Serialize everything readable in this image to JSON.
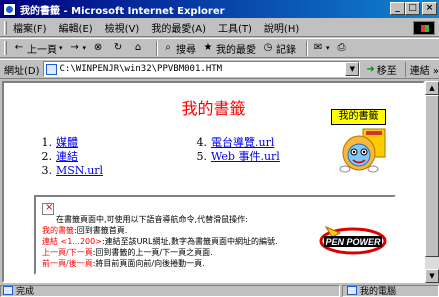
{
  "window": {
    "title": "我的書籤 - Microsoft Internet Explorer",
    "minimize": "_",
    "maximize": "□",
    "close": "×"
  },
  "menu": [
    "檔案(F)",
    "編輯(E)",
    "檢視(V)",
    "我的最愛(A)",
    "工具(T)",
    "說明(H)"
  ],
  "toolbar": {
    "back": "上一頁",
    "back_icon": "←",
    "forward_icon": "→",
    "stop_icon": "⊗",
    "refresh_icon": "↻",
    "home_icon": "⌂",
    "search": "搜尋",
    "search_icon": "⌕",
    "favorites": "我的最愛",
    "favorites_icon": "★",
    "history": "記錄",
    "history_icon": "◷",
    "mail_icon": "✉",
    "print_icon": "⎙"
  },
  "address": {
    "label": "網址(D)",
    "value": "C:\\WINPENJR\\win32\\PPVBM001.HTM",
    "go": "移至",
    "links": "連結 »"
  },
  "page": {
    "heading": "我的書籤",
    "mascot_label": "我的書籤",
    "favorites_left": [
      {
        "num": "1.",
        "text": "媒體"
      },
      {
        "num": "2.",
        "text": "連結"
      },
      {
        "num": "3.",
        "text": "MSN.url"
      }
    ],
    "favorites_right": [
      {
        "num": "4.",
        "text": "電台導覽.url"
      },
      {
        "num": "5.",
        "text": "Web 事件.url"
      }
    ],
    "info": {
      "intro": "在書籤頁面中,可使用以下語音導航命令,代替滑鼠操作:",
      "lines": [
        {
          "key": "我的書籤",
          "desc": ":回到書籤首頁."
        },
        {
          "key": "連結 <1...200>",
          "desc": ":連結至該URL網址,數字為書籤頁面中網址的編號."
        },
        {
          "key": "上一頁/下一頁",
          "desc": ":回到書籤的上一頁/下一頁之頁面."
        },
        {
          "key": "前一頁/後一頁",
          "desc": ":將目前頁面向前/向後捲動一頁."
        }
      ],
      "logo_text": "PEN POWER"
    }
  },
  "status": {
    "left": "完成",
    "right": "我的電腦"
  },
  "colors": {
    "title_start": "#000080",
    "title_end": "#1084d0",
    "heading": "#ff0000",
    "link": "#0000ee",
    "highlight": "#ffff00"
  }
}
